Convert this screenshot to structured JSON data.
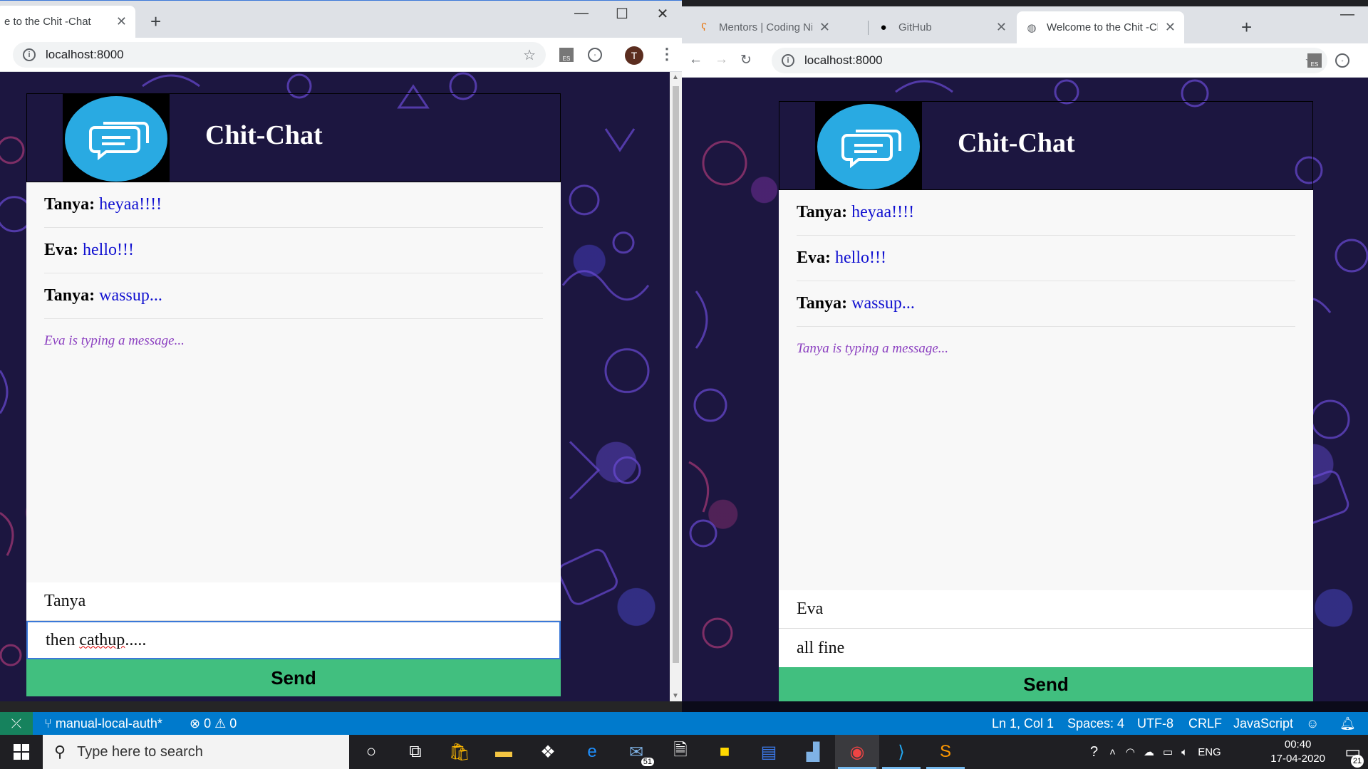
{
  "left_window": {
    "tab_title": "e to the Chit -Chat",
    "url": "localhost:8000",
    "profile_initial": "T",
    "ext_label": "ES",
    "app": {
      "title": "Chit-Chat",
      "messages": [
        {
          "who": "Tanya:",
          "text": "heyaa!!!!"
        },
        {
          "who": "Eva:",
          "text": "hello!!!"
        },
        {
          "who": "Tanya:",
          "text": "wassup..."
        }
      ],
      "typing": "Eva is typing a message...",
      "name_value": "Tanya",
      "message_value_plain": "then ",
      "message_value_misspelled": "cathup",
      "message_value_tail": ".....",
      "send_label": "Send"
    }
  },
  "right_window": {
    "tabs": [
      {
        "title": "Mentors | Coding Ninjas",
        "icon": "coding-ninjas-icon"
      },
      {
        "title": "GitHub",
        "icon": "github-icon"
      },
      {
        "title": "Welcome to the Chit -Chat",
        "icon": "globe-icon"
      }
    ],
    "url": "localhost:8000",
    "ext_label": "ES",
    "app": {
      "title": "Chit-Chat",
      "messages": [
        {
          "who": "Tanya:",
          "text": "heyaa!!!!"
        },
        {
          "who": "Eva:",
          "text": "hello!!!"
        },
        {
          "who": "Tanya:",
          "text": "wassup..."
        }
      ],
      "typing": "Tanya is typing a message...",
      "name_value": "Eva",
      "message_value": "all fine",
      "send_label": "Send"
    }
  },
  "vscode_status": {
    "branch": "manual-local-auth*",
    "errors": "0",
    "warnings": "0",
    "position": "Ln 1, Col 1",
    "spaces": "Spaces: 4",
    "encoding": "UTF-8",
    "eol": "CRLF",
    "language": "JavaScript"
  },
  "taskbar": {
    "search_placeholder": "Type here to search",
    "mail_badge": "51",
    "language": "ENG",
    "time": "00:40",
    "date": "17-04-2020",
    "notification_count": "21"
  },
  "colors": {
    "send_button": "#41bf7f",
    "message_text": "#1010d0",
    "typing_text": "#8b3fc0",
    "logo_blue": "#29aae2",
    "status_bar": "#007acc"
  }
}
